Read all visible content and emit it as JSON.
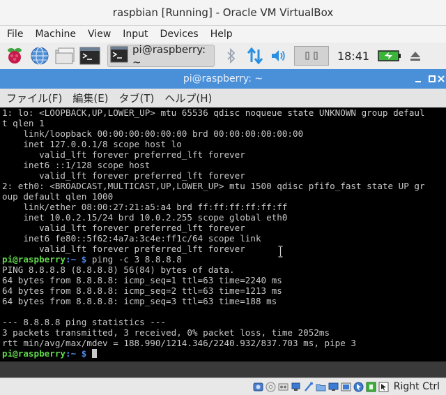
{
  "vbox": {
    "title": "raspbian [Running] - Oracle VM VirtualBox",
    "menu": [
      "File",
      "Machine",
      "View",
      "Input",
      "Devices",
      "Help"
    ],
    "host_key": "Right Ctrl"
  },
  "taskbar": {
    "launchers": [
      "raspberry-menu-icon",
      "web-browser-icon",
      "file-manager-icon",
      "terminal-icon"
    ],
    "active_task": "pi@raspberry: ~",
    "clock": "18:41",
    "colors": {
      "battery": "#3cb43c",
      "bluetooth": "#9aa4b0",
      "network": "#2b8fe0",
      "volume": "#2b8fe0"
    }
  },
  "terminal": {
    "title": "pi@raspberry: ~",
    "menu": [
      "ファイル(F)",
      "編集(E)",
      "タブ(T)",
      "ヘルプ(H)"
    ],
    "prompt_user": "pi@raspberry",
    "prompt_sep": ":~ $",
    "lines": [
      {
        "text": "1: lo: <LOOPBACK,UP,LOWER_UP> mtu 65536 qdisc noqueue state UNKNOWN group defaul"
      },
      {
        "text": "t qlen 1"
      },
      {
        "text": "    link/loopback 00:00:00:00:00:00 brd 00:00:00:00:00:00"
      },
      {
        "text": "    inet 127.0.0.1/8 scope host lo"
      },
      {
        "text": "       valid_lft forever preferred_lft forever"
      },
      {
        "text": "    inet6 ::1/128 scope host"
      },
      {
        "text": "       valid_lft forever preferred_lft forever"
      },
      {
        "text": "2: eth0: <BROADCAST,MULTICAST,UP,LOWER_UP> mtu 1500 qdisc pfifo_fast state UP gr"
      },
      {
        "text": "oup default qlen 1000"
      },
      {
        "text": "    link/ether 08:00:27:21:a5:a4 brd ff:ff:ff:ff:ff:ff"
      },
      {
        "text": "    inet 10.0.2.15/24 brd 10.0.2.255 scope global eth0"
      },
      {
        "text": "       valid_lft forever preferred_lft forever"
      },
      {
        "text": "    inet6 fe80::5f62:4a7a:3c4e:ff1c/64 scope link"
      },
      {
        "text": "       valid_lft forever preferred_lft forever"
      },
      {
        "prompt": true,
        "text": " ping -c 3 8.8.8.8"
      },
      {
        "text": "PING 8.8.8.8 (8.8.8.8) 56(84) bytes of data."
      },
      {
        "text": "64 bytes from 8.8.8.8: icmp_seq=1 ttl=63 time=2240 ms"
      },
      {
        "text": "64 bytes from 8.8.8.8: icmp_seq=2 ttl=63 time=1213 ms"
      },
      {
        "text": "64 bytes from 8.8.8.8: icmp_seq=3 ttl=63 time=188 ms"
      },
      {
        "text": ""
      },
      {
        "text": "--- 8.8.8.8 ping statistics ---"
      },
      {
        "text": "3 packets transmitted, 3 received, 0% packet loss, time 2052ms"
      },
      {
        "text": "rtt min/avg/max/mdev = 188.990/1214.346/2240.932/837.703 ms, pipe 3"
      },
      {
        "prompt": true,
        "text": " ",
        "cursor": true
      }
    ],
    "colors": {
      "prompt_user": "#60d84a",
      "prompt_sep": "#4f8cf0",
      "titlebar": "#4a90d9"
    }
  },
  "statusbar": {
    "icons": [
      "hard-disk-icon",
      "optical-drive-icon",
      "audio-icon",
      "network-adapter-icon",
      "usb-icon",
      "shared-folder-icon",
      "display-icon",
      "video-capture-icon",
      "mouse-integration-icon",
      "guest-additions-icon",
      "host-key-arrow-icon"
    ]
  }
}
